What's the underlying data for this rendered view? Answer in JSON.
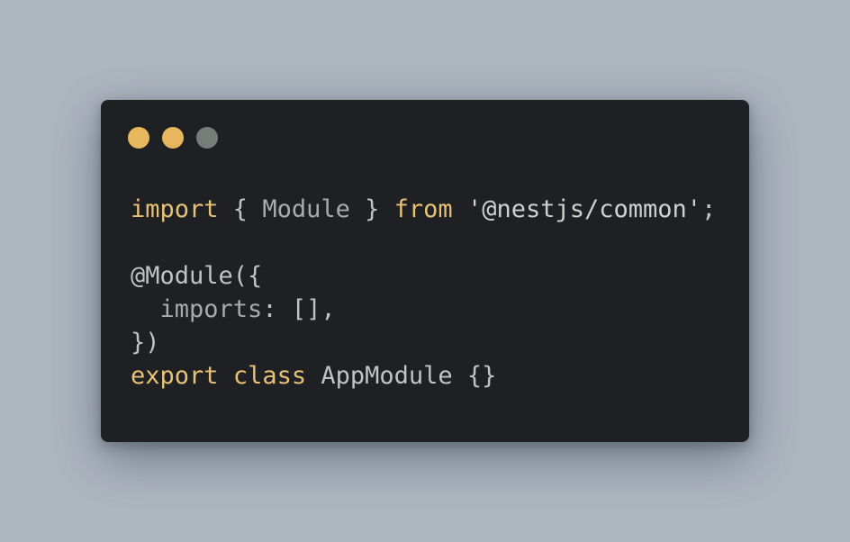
{
  "window": {
    "controls": [
      {
        "name": "close",
        "color": "#e6b75c"
      },
      {
        "name": "minimize",
        "color": "#e6b75c"
      },
      {
        "name": "zoom",
        "color": "#757d79"
      }
    ]
  },
  "code": {
    "lines": [
      [
        {
          "text": "import",
          "kind": "kw"
        },
        {
          "text": " { ",
          "kind": "punct"
        },
        {
          "text": "Module",
          "kind": "ident"
        },
        {
          "text": " } ",
          "kind": "punct"
        },
        {
          "text": "from",
          "kind": "kw"
        },
        {
          "text": " ",
          "kind": "punct"
        },
        {
          "text": "'@nestjs/common'",
          "kind": "str"
        },
        {
          "text": ";",
          "kind": "punct"
        }
      ],
      [],
      [
        {
          "text": "@Module({",
          "kind": "plain"
        }
      ],
      [
        {
          "text": "  ",
          "kind": "plain"
        },
        {
          "text": "imports",
          "kind": "ident"
        },
        {
          "text": ": [],",
          "kind": "plain"
        }
      ],
      [
        {
          "text": "})",
          "kind": "plain"
        }
      ],
      [
        {
          "text": "export",
          "kind": "kw"
        },
        {
          "text": " ",
          "kind": "plain"
        },
        {
          "text": "class",
          "kind": "kw"
        },
        {
          "text": " AppModule {}",
          "kind": "plain"
        }
      ]
    ]
  },
  "colors": {
    "background": "#aeb6c0",
    "window": "#1f2023",
    "keyword": "#e6c177",
    "text": "#c2c2c2"
  }
}
